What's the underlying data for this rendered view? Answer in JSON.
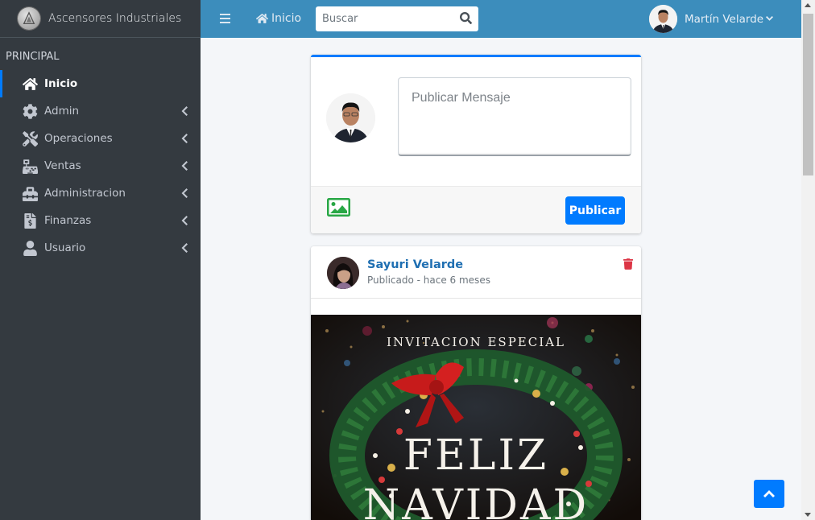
{
  "brand": {
    "name": "Ascensores Industriales"
  },
  "sidebar": {
    "header": "PRINCIPAL",
    "items": [
      {
        "label": "Inicio",
        "icon": "home-icon",
        "active": true
      },
      {
        "label": "Admin",
        "icon": "gear-icon"
      },
      {
        "label": "Operaciones",
        "icon": "tools-icon"
      },
      {
        "label": "Ventas",
        "icon": "cash-register-icon"
      },
      {
        "label": "Administracion",
        "icon": "toolbox-icon"
      },
      {
        "label": "Finanzas",
        "icon": "file-invoice-dollar-icon"
      },
      {
        "label": "Usuario",
        "icon": "user-icon"
      }
    ]
  },
  "topbar": {
    "home_label": "Inicio",
    "search_placeholder": "Buscar",
    "user_name": "Martín Velarde"
  },
  "composer": {
    "placeholder": "Publicar Mensaje",
    "publish_label": "Publicar"
  },
  "post": {
    "author": "Sayuri Velarde",
    "meta": "Publicado - hace 6 meses",
    "image_text_top": "INVITACION ESPECIAL",
    "image_text_line1": "FELIZ",
    "image_text_line2": "NAVIDAD"
  },
  "colors": {
    "sidebar": "#343a40",
    "navbar": "#3c8dbc",
    "primary": "#007bff",
    "danger": "#dc3545",
    "image_icon": "#28a745"
  }
}
